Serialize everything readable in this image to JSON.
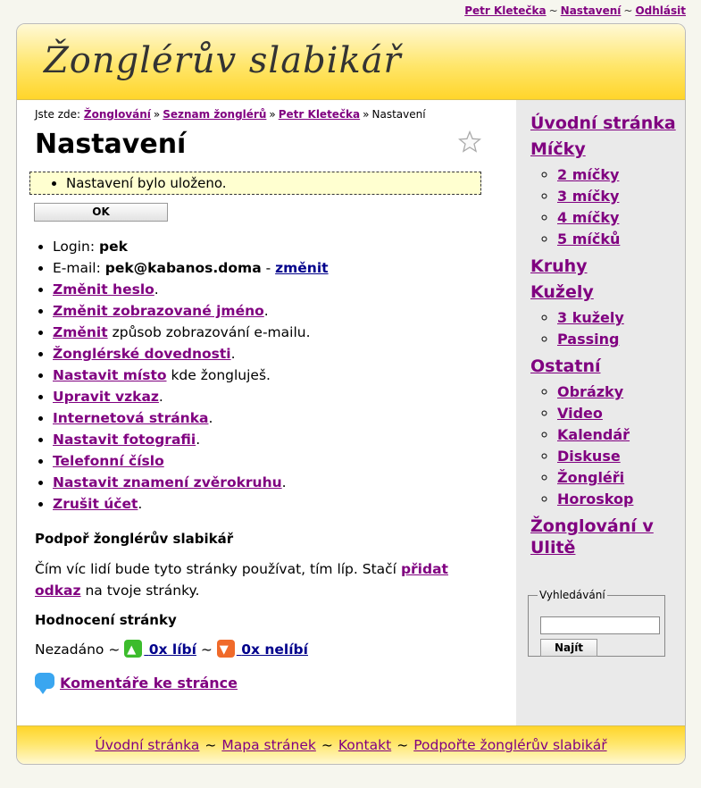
{
  "topbar": {
    "user": "Petr Kletečka",
    "settings": "Nastavení",
    "logout": "Odhlásit",
    "sep": "~"
  },
  "header": {
    "logo": "Žonglérův slabikář"
  },
  "breadcrumb": {
    "prefix": "Jste zde:",
    "items": [
      "Žonglování",
      "Seznam žonglérů",
      "Petr Kletečka"
    ],
    "current": "Nastavení",
    "sep": "»"
  },
  "page_title": "Nastavení",
  "notice": "Nastavení bylo uloženo.",
  "ok_button": "OK",
  "settings": {
    "login_label": "Login:",
    "login_value": "pek",
    "email_label": "E-mail:",
    "email_value": "pek@kabanos.doma",
    "email_sep": "-",
    "email_change": "změnit",
    "change_password": "Změnit heslo",
    "change_name": "Změnit zobrazované jméno",
    "change_email_display_link": "Změnit",
    "change_email_display_text": "způsob zobrazování e-mailu.",
    "skills": "Žonglérské dovednosti",
    "place_link": "Nastavit místo",
    "place_text": "kde žongluješ.",
    "message": "Upravit vzkaz",
    "website": "Internetová stránka",
    "photo": "Nastavit fotografii",
    "phone": "Telefonní číslo",
    "zodiac": "Nastavit znamení zvěrokruhu",
    "cancel_account": "Zrušit účet",
    "dot": "."
  },
  "support": {
    "title": "Podpoř žonglérův slabikář",
    "text_before": "Čím víc lidí bude tyto stránky používat, tím líp. Stačí",
    "link": "přidat odkaz",
    "text_after": "na tvoje stránky."
  },
  "rating": {
    "title": "Hodnocení stránky",
    "status": "Nezadáno",
    "sep": "~",
    "like": "0x líbí",
    "dislike": "0x nelíbí"
  },
  "comments": "Komentáře ke stránce",
  "sidebar": {
    "home": "Úvodní stránka",
    "balls": "Míčky",
    "balls_items": [
      "2 míčky",
      "3 míčky",
      "4 míčky",
      "5 míčků"
    ],
    "rings": "Kruhy",
    "clubs": "Kužely",
    "clubs_items": [
      "3 kužely",
      "Passing"
    ],
    "other": "Ostatní",
    "other_items": [
      "Obrázky",
      "Video",
      "Kalendář",
      "Diskuse",
      "Žongléři",
      "Horoskop"
    ],
    "ulita": "Žonglování v Ulitě",
    "search_legend": "Vyhledávání",
    "search_value": "",
    "search_button": "Najít"
  },
  "footer": {
    "home": "Úvodní stránka",
    "sitemap": "Mapa stránek",
    "contact": "Kontakt",
    "support": "Podpořte žonglérův slabikář",
    "sep": "~"
  }
}
